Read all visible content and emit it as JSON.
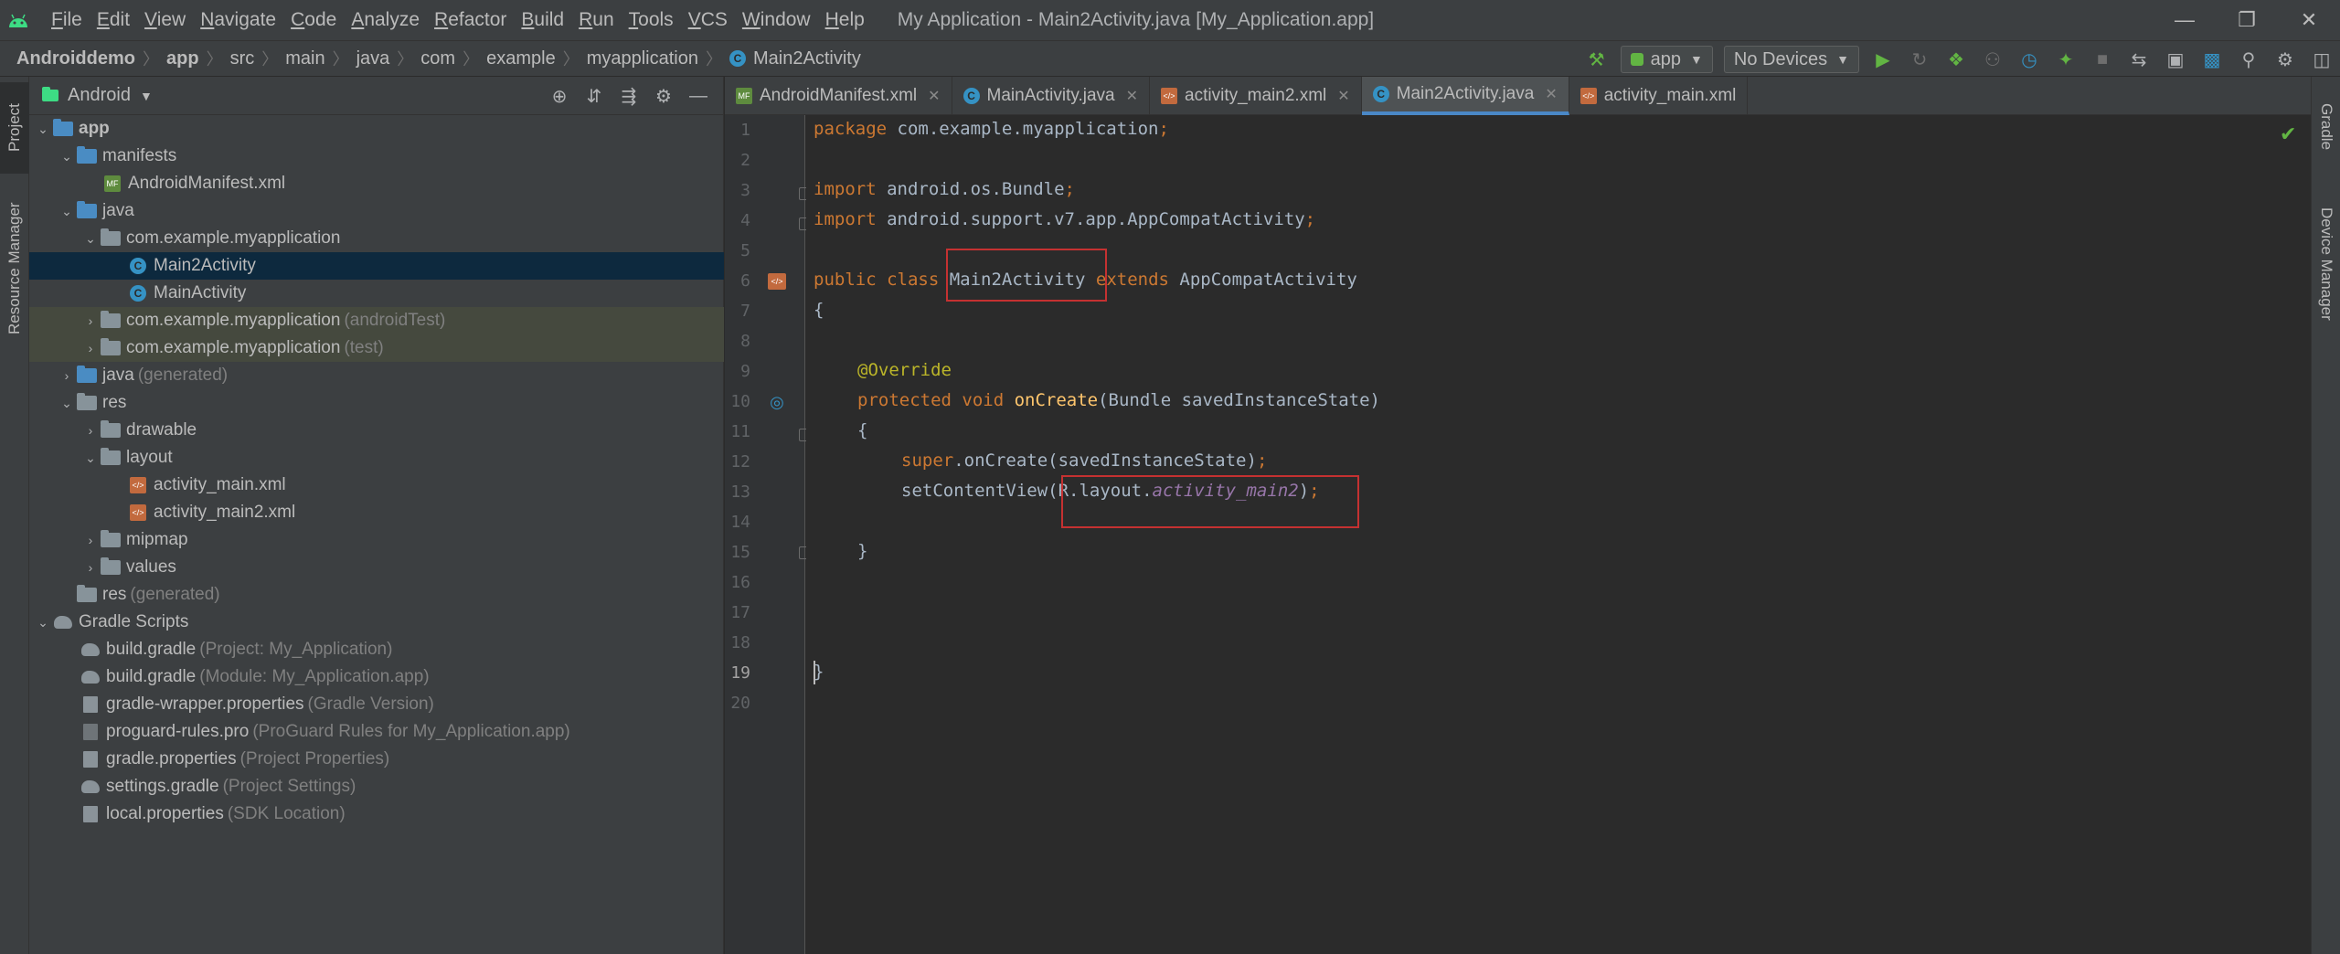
{
  "menu": [
    "File",
    "Edit",
    "View",
    "Navigate",
    "Code",
    "Analyze",
    "Refactor",
    "Build",
    "Run",
    "Tools",
    "VCS",
    "Window",
    "Help"
  ],
  "window_title": "My Application - Main2Activity.java [My_Application.app]",
  "breadcrumbs": [
    "Androiddemo",
    "app",
    "src",
    "main",
    "java",
    "com",
    "example",
    "myapplication",
    "Main2Activity"
  ],
  "toolbar": {
    "run_config": "app",
    "device": "No Devices"
  },
  "left_strip": {
    "project": "Project",
    "resource_manager": "Resource Manager"
  },
  "right_strip": {
    "gradle": "Gradle",
    "device_manager": "Device Manager"
  },
  "project_panel": {
    "view": "Android"
  },
  "tree": [
    {
      "name": "app",
      "hint": ""
    },
    {
      "name": "manifests",
      "hint": ""
    },
    {
      "name": "AndroidManifest.xml",
      "hint": ""
    },
    {
      "name": "java",
      "hint": ""
    },
    {
      "name": "com.example.myapplication",
      "hint": ""
    },
    {
      "name": "Main2Activity",
      "hint": ""
    },
    {
      "name": "MainActivity",
      "hint": ""
    },
    {
      "name": "com.example.myapplication",
      "hint": "(androidTest)"
    },
    {
      "name": "com.example.myapplication",
      "hint": "(test)"
    },
    {
      "name": "java",
      "hint": "(generated)"
    },
    {
      "name": "res",
      "hint": ""
    },
    {
      "name": "drawable",
      "hint": ""
    },
    {
      "name": "layout",
      "hint": ""
    },
    {
      "name": "activity_main.xml",
      "hint": ""
    },
    {
      "name": "activity_main2.xml",
      "hint": ""
    },
    {
      "name": "mipmap",
      "hint": ""
    },
    {
      "name": "values",
      "hint": ""
    },
    {
      "name": "res",
      "hint": "(generated)"
    },
    {
      "name": "Gradle Scripts",
      "hint": ""
    },
    {
      "name": "build.gradle",
      "hint": "(Project: My_Application)"
    },
    {
      "name": "build.gradle",
      "hint": "(Module: My_Application.app)"
    },
    {
      "name": "gradle-wrapper.properties",
      "hint": "(Gradle Version)"
    },
    {
      "name": "proguard-rules.pro",
      "hint": "(ProGuard Rules for My_Application.app)"
    },
    {
      "name": "gradle.properties",
      "hint": "(Project Properties)"
    },
    {
      "name": "settings.gradle",
      "hint": "(Project Settings)"
    },
    {
      "name": "local.properties",
      "hint": "(SDK Location)"
    }
  ],
  "tabs": [
    "AndroidManifest.xml",
    "MainActivity.java",
    "activity_main2.xml",
    "Main2Activity.java",
    "activity_main.xml"
  ],
  "line_numbers": [
    "1",
    "2",
    "3",
    "4",
    "5",
    "6",
    "7",
    "8",
    "9",
    "10",
    "11",
    "12",
    "13",
    "14",
    "15",
    "16",
    "17",
    "18",
    "19",
    "20"
  ],
  "code": {
    "l1_kw": "package",
    "l1_rest": " com.example.myapplication",
    "l1_semi": ";",
    "l3_kw": "import",
    "l3_rest": " android.os.Bundle",
    "l3_semi": ";",
    "l4_kw": "import",
    "l4_rest": " android.support.v7.app.AppCompatActivity",
    "l4_semi": ";",
    "l6_kw": "public class ",
    "l6_cls": "Main2Activity",
    "l6_ext": " extends ",
    "l6_base": "AppCompatActivity",
    "l7": "{",
    "l9": "@Override",
    "l10_kw": "protected void ",
    "l10_fn": "onCreate",
    "l10_rest": "(Bundle savedInstanceState)",
    "l11": "{",
    "l12_kw": "super",
    "l12_rest": ".onCreate(savedInstanceState)",
    "l12_semi": ";",
    "l13_a": "setContentView(R.layout.",
    "l13_fld": "activity_main2",
    "l13_b": ")",
    "l13_semi": ";",
    "l15": "}",
    "l18": "}"
  }
}
